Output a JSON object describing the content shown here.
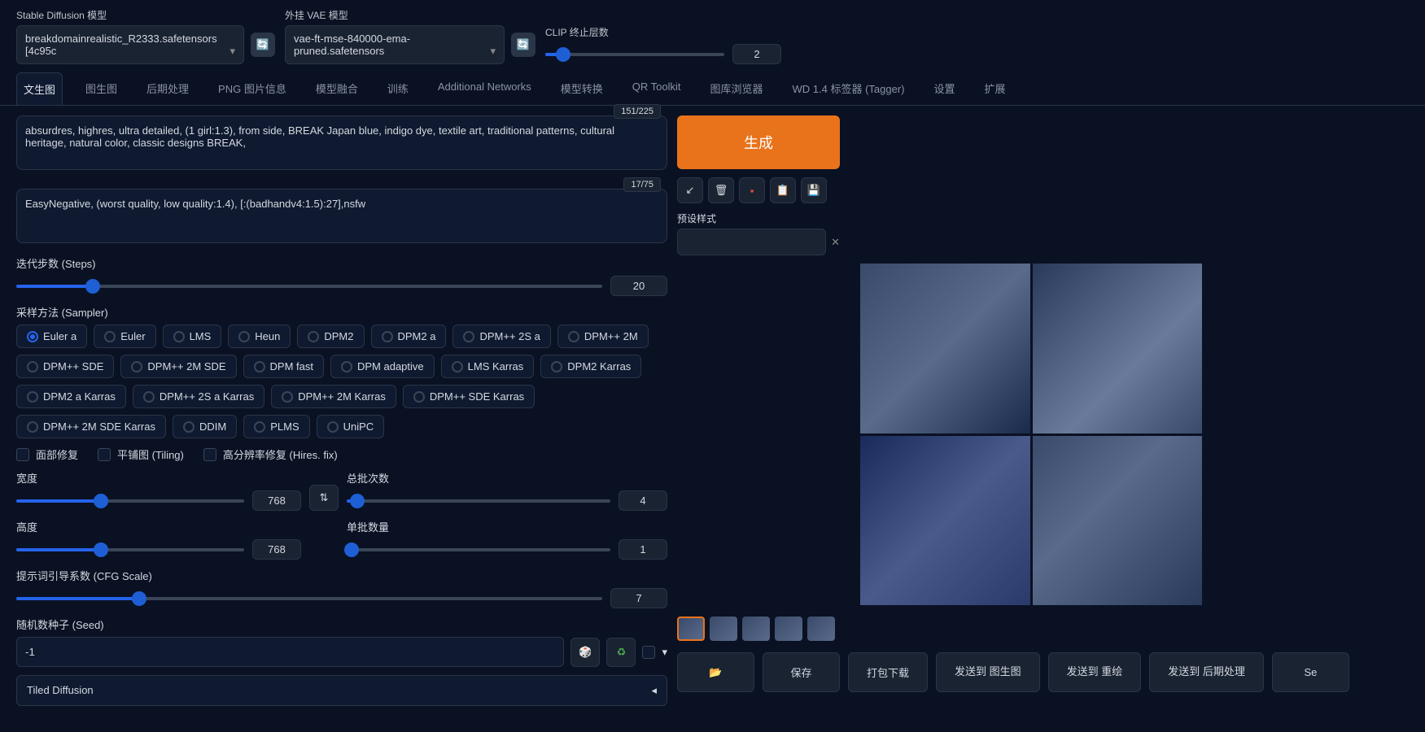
{
  "top": {
    "sd_label": "Stable Diffusion 模型",
    "sd_value": "breakdomainrealistic_R2333.safetensors [4c95c",
    "vae_label": "外挂 VAE 模型",
    "vae_value": "vae-ft-mse-840000-ema-pruned.safetensors",
    "clip_label": "CLIP 终止层数",
    "clip_value": "2"
  },
  "tabs": [
    "文生图",
    "图生图",
    "后期处理",
    "PNG 图片信息",
    "模型融合",
    "训练",
    "Additional Networks",
    "模型转换",
    "QR Toolkit",
    "图库浏览器",
    "WD 1.4 标签器 (Tagger)",
    "设置",
    "扩展"
  ],
  "prompt": {
    "positive": "absurdres, highres, ultra detailed, (1 girl:1.3), from side, BREAK Japan blue, indigo dye, textile art, traditional patterns, cultural heritage, natural color, classic designs BREAK,",
    "positive_count": "151/225",
    "negative": "EasyNegative, (worst quality, low quality:1.4), [:(badhandv4:1.5):27],nsfw",
    "negative_count": "17/75"
  },
  "generate": {
    "button": "生成",
    "preset_label": "预设样式"
  },
  "settings": {
    "steps_label": "迭代步数 (Steps)",
    "steps_value": "20",
    "sampler_label": "采样方法 (Sampler)",
    "samplers": [
      "Euler a",
      "Euler",
      "LMS",
      "Heun",
      "DPM2",
      "DPM2 a",
      "DPM++ 2S a",
      "DPM++ 2M",
      "DPM++ SDE",
      "DPM++ 2M SDE",
      "DPM fast",
      "DPM adaptive",
      "LMS Karras",
      "DPM2 Karras",
      "DPM2 a Karras",
      "DPM++ 2S a Karras",
      "DPM++ 2M Karras",
      "DPM++ SDE Karras",
      "DPM++ 2M SDE Karras",
      "DDIM",
      "PLMS",
      "UniPC"
    ],
    "checks": {
      "face": "面部修复",
      "tiling": "平铺图 (Tiling)",
      "hires": "高分辨率修复 (Hires. fix)"
    },
    "width_label": "宽度",
    "width_value": "768",
    "height_label": "高度",
    "height_value": "768",
    "batch_count_label": "总批次数",
    "batch_count_value": "4",
    "batch_size_label": "单批数量",
    "batch_size_value": "1",
    "cfg_label": "提示词引导系数 (CFG Scale)",
    "cfg_value": "7",
    "seed_label": "随机数种子 (Seed)",
    "seed_value": "-1",
    "tiled_diffusion": "Tiled Diffusion"
  },
  "actions": {
    "folder": "📂",
    "save": "保存",
    "zip": "打包下载",
    "to_img2img": "发送到 图生图",
    "to_inpaint": "发送到 重绘",
    "to_extras": "发送到 后期处理",
    "send": "Se"
  },
  "icons": {
    "refresh": "🔄",
    "arrow": "↙",
    "trash": "🗑",
    "note": "📋",
    "clipboard": "📋",
    "save": "💾",
    "dice": "🎲",
    "recycle": "♻",
    "swap": "⇅",
    "tri": "▸",
    "close": "✕"
  }
}
